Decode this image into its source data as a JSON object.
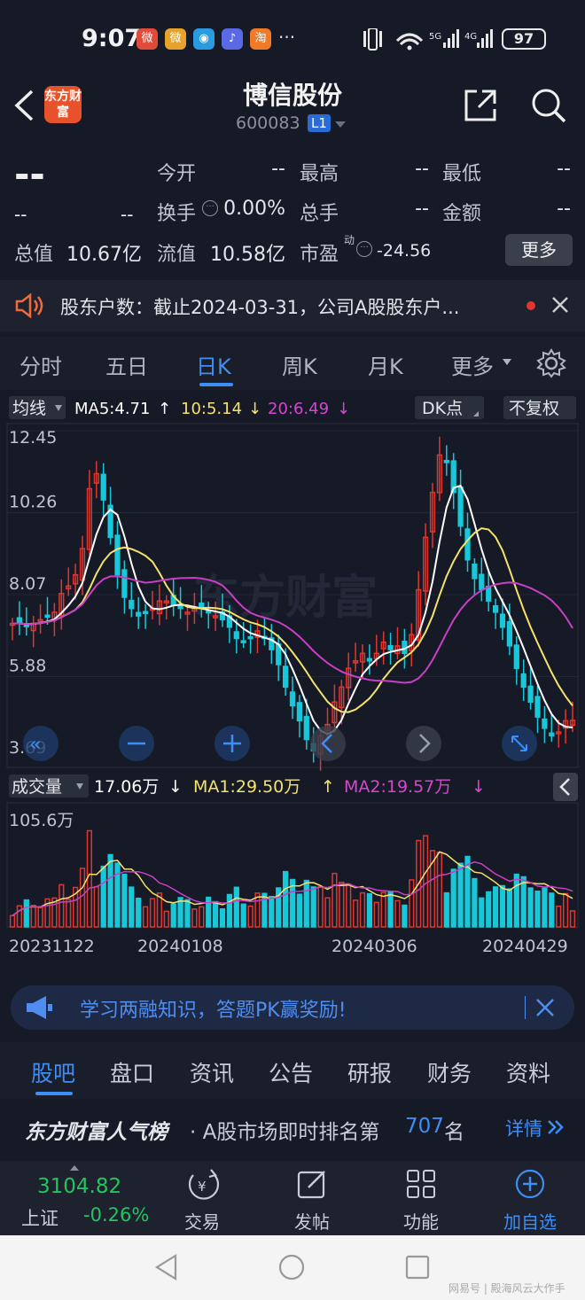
{
  "status_bar": {
    "time": "9:07",
    "battery": "97",
    "notif_icons": [
      "weibo-icon",
      "weibo-icon",
      "browser-icon",
      "music-icon",
      "taobao-icon"
    ],
    "more": "···"
  },
  "header": {
    "title": "博信股份",
    "code": "600083",
    "level": "L1",
    "logo": "东方财富"
  },
  "quote": {
    "price": "--",
    "change": "--",
    "change_pct": "--",
    "open_label": "今开",
    "open": "--",
    "high_label": "最高",
    "high": "--",
    "low_label": "最低",
    "low": "--",
    "turnover_label": "换手",
    "turnover": "0.00%",
    "volume_label": "总手",
    "volume": "--",
    "amount_label": "金额",
    "amount": "--",
    "mktcap_label": "总值",
    "mktcap": "10.67亿",
    "float_label": "流值",
    "float": "10.58亿",
    "pe_label": "市盈",
    "pe_sup": "动",
    "pe": "-24.56",
    "more": "更多"
  },
  "notice": {
    "text": "股东户数：截止2024-03-31，公司A股股东户..."
  },
  "period_tabs": [
    "分时",
    "五日",
    "日K",
    "周K",
    "月K",
    "更多"
  ],
  "active_tab": 2,
  "kline": {
    "ma_selector": "均线",
    "ma5": "MA5:4.71",
    "ma10": "10:5.14",
    "ma20": "20:6.49",
    "dk": "DK点",
    "adjust": "不复权",
    "y_labels": [
      "12.45",
      "10.26",
      "8.07",
      "5.88",
      "3.69"
    ],
    "watermark": "东方财富",
    "vol_selector": "成交量",
    "vol": "17.06万",
    "vol_ma1": "MA1:29.50万",
    "vol_ma2": "MA2:19.57万",
    "vol_max": "105.6万",
    "dates": [
      "20231122",
      "20240108",
      "20240306",
      "20240429"
    ]
  },
  "colors": {
    "up": "#e0362f",
    "down": "#18c7d8",
    "ma5": "#ffffff",
    "ma10": "#f5e26b",
    "ma20": "#c93fc4",
    "accent": "#3d8ef5"
  },
  "chart_data": {
    "type": "candlestick",
    "y_range": [
      3.69,
      12.45
    ],
    "close": [
      7.3,
      7.3,
      7.25,
      7.3,
      7.4,
      7.5,
      7.6,
      8.1,
      8.3,
      8.6,
      9.3,
      10.9,
      11.3,
      10.6,
      9.6,
      8.6,
      8.0,
      7.7,
      7.5,
      7.6,
      7.7,
      7.9,
      7.9,
      7.8,
      7.7,
      7.6,
      7.7,
      7.7,
      7.6,
      7.5,
      7.4,
      7.2,
      6.9,
      6.8,
      6.9,
      7.1,
      6.9,
      6.6,
      6.2,
      5.6,
      5.1,
      4.7,
      4.2,
      3.9,
      4.3,
      4.6,
      5.2,
      5.6,
      6.1,
      6.3,
      6.5,
      6.3,
      6.5,
      6.8,
      6.6,
      6.7,
      6.5,
      7.0,
      8.2,
      9.6,
      10.8,
      11.8,
      11.6,
      10.8,
      9.9,
      9.0,
      8.5,
      8.2,
      7.9,
      7.6,
      7.2,
      6.7,
      6.1,
      5.6,
      5.2,
      4.8,
      4.5,
      4.3,
      4.4,
      4.7,
      4.71
    ],
    "vol_max": 105.6,
    "vol_last": 17.06,
    "vol_ma1": 29.5,
    "vol_ma2": 19.57
  },
  "banner": {
    "text": "学习两融知识，答题PK赢奖励!"
  },
  "bottom_tabs": [
    "股吧",
    "盘口",
    "资讯",
    "公告",
    "研报",
    "财务",
    "资料"
  ],
  "rank": {
    "brand": "东方财富人气榜",
    "text": "· A股市场即时排名第",
    "num": "707",
    "suffix": "名",
    "detail": "详情"
  },
  "nav": {
    "index_value": "3104.82",
    "index_name": "上证",
    "index_change": "-0.26%",
    "trade": "交易",
    "post": "发帖",
    "func": "功能",
    "add": "加自选"
  },
  "watermark_site": "网易号 | 殿海风云大作手"
}
